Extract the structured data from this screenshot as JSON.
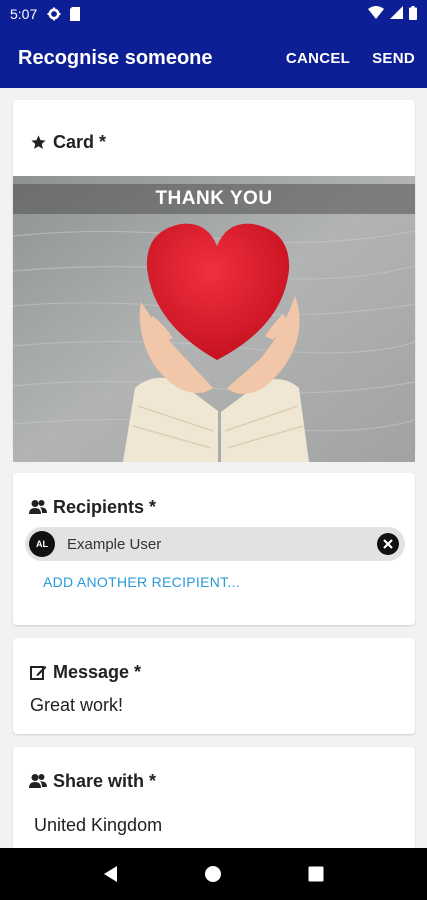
{
  "status_bar": {
    "time": "5:07",
    "icons": [
      "gear-icon",
      "sd-card-icon",
      "wifi-icon",
      "signal-icon",
      "battery-icon"
    ]
  },
  "app_bar": {
    "title": "Recognise someone",
    "cancel_label": "CANCEL",
    "send_label": "SEND",
    "color": "#0d1f94"
  },
  "card_section": {
    "header": "Card *",
    "icon": "star-icon",
    "image_caption": "THANK YOU"
  },
  "recipients_section": {
    "header": "Recipients *",
    "icon": "users-icon",
    "chips": [
      {
        "initials": "AL",
        "name": "Example User"
      }
    ],
    "add_label": "ADD ANOTHER RECIPIENT..."
  },
  "message_section": {
    "header": "Message *",
    "icon": "edit-icon",
    "value": "Great work!"
  },
  "share_section": {
    "header": "Share with *",
    "icon": "users-icon",
    "value": "United Kingdom"
  },
  "nav_bar": {
    "buttons": [
      "back-icon",
      "home-icon",
      "recents-icon"
    ]
  }
}
